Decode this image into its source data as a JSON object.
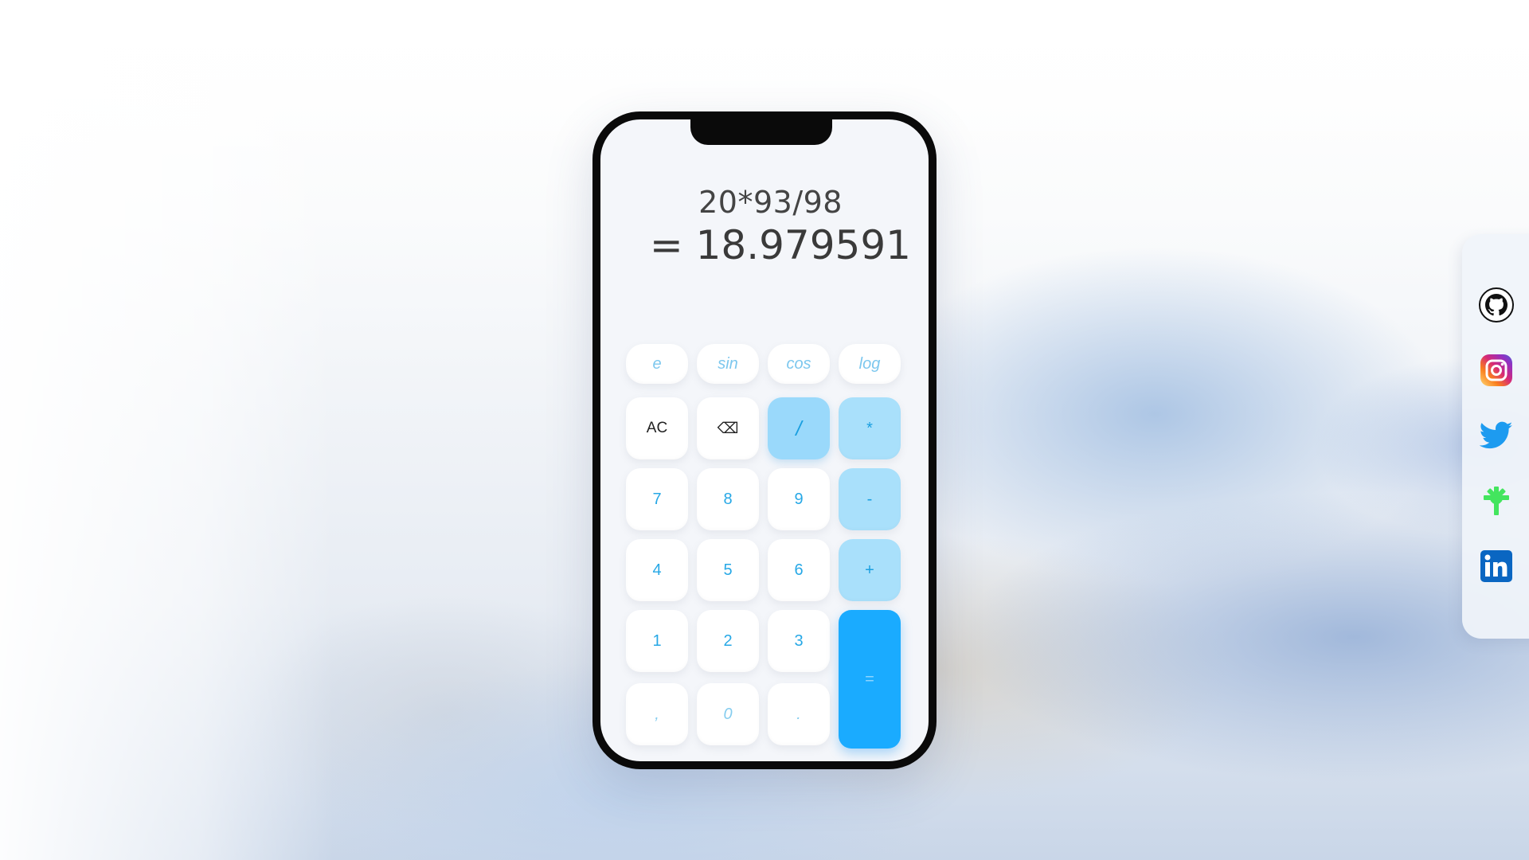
{
  "calculator": {
    "expression": "20*93/98",
    "result": "= 18.979591",
    "function_keys": [
      "e",
      "sin",
      "cos",
      "log"
    ],
    "keys": {
      "clear": "AC",
      "backspace": "⌫",
      "divide": "/",
      "multiply": "*",
      "seven": "7",
      "eight": "8",
      "nine": "9",
      "minus": "-",
      "four": "4",
      "five": "5",
      "six": "6",
      "plus": "+",
      "one": "1",
      "two": "2",
      "three": "3",
      "equals": "=",
      "comma": ",",
      "zero": "0",
      "dot": "."
    },
    "colors": {
      "accent": "#1aabff",
      "operator_bg": "#a9e0fb",
      "key_text": "#27a8e6"
    }
  },
  "social": {
    "icons": [
      "github-icon",
      "instagram-icon",
      "twitter-icon",
      "linktree-icon",
      "linkedin-icon"
    ]
  }
}
